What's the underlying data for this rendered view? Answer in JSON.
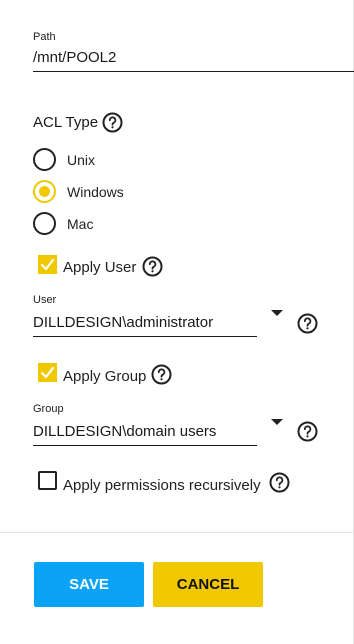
{
  "path": {
    "label": "Path",
    "value": "/mnt/POOL2"
  },
  "acl": {
    "title": "ACL Type",
    "options": [
      {
        "label": "Unix",
        "selected": false
      },
      {
        "label": "Windows",
        "selected": true
      },
      {
        "label": "Mac",
        "selected": false
      }
    ]
  },
  "apply_user": {
    "label": "Apply User",
    "checked": true
  },
  "user": {
    "label": "User",
    "value": "DILLDESIGN\\administrator"
  },
  "apply_group": {
    "label": "Apply Group",
    "checked": true
  },
  "group": {
    "label": "Group",
    "value": "DILLDESIGN\\domain users"
  },
  "recursive": {
    "label": "Apply permissions recursively",
    "checked": false
  },
  "actions": {
    "save_label": "SAVE",
    "cancel_label": "CANCEL"
  },
  "colors": {
    "accent": "#f0c800",
    "primary": "#0aa3f5"
  },
  "icons": {
    "help": "help-circle-icon",
    "dropdown": "caret-down-icon",
    "check": "checkmark-icon"
  }
}
